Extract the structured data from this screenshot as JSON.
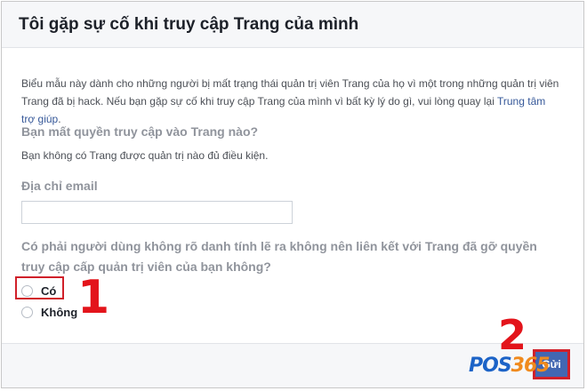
{
  "header": {
    "title": "Tôi gặp sự cố khi truy cập Trang của mình"
  },
  "intro": {
    "text": "Biểu mẫu này dành cho những người bị mất trạng thái quản trị viên Trang của họ vì một trong những quản trị viên Trang đã bị hack. Nếu bạn gặp sự cố khi truy cập Trang của mình vì bất kỳ lý do gì, vui lòng quay lại ",
    "link": "Trung tâm trợ giúp",
    "end": "."
  },
  "question_page": {
    "label": "Bạn mất quyền truy cập vào Trang nào?",
    "note": "Bạn không có Trang được quản trị nào đủ điều kiện."
  },
  "email": {
    "label": "Địa chỉ email",
    "value": "",
    "placeholder": ""
  },
  "question_unknown": {
    "label": "Có phải người dùng không rõ danh tính lẽ ra không nên liên kết với Trang đã gỡ quyền truy cập cấp quản trị viên của bạn không?",
    "options": [
      "Có",
      "Không"
    ]
  },
  "annotations": {
    "step1": "1",
    "step2": "2"
  },
  "footer": {
    "submit_label": "Gửi"
  },
  "watermark": {
    "part1": "POS",
    "part2": "365"
  },
  "colors": {
    "accent": "#4267b2",
    "annotation": "#e3141b",
    "link": "#365899"
  }
}
